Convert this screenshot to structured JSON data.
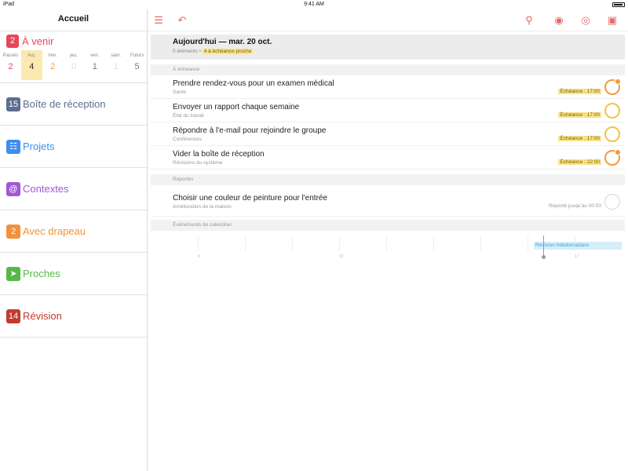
{
  "status": {
    "device": "iPad",
    "time": "9:41 AM"
  },
  "sidebar": {
    "title": "Accueil",
    "upcoming": {
      "count": "2",
      "label": "À venir",
      "days": [
        {
          "label": "Passés",
          "value": "2"
        },
        {
          "label": "Auj.",
          "value": "4"
        },
        {
          "label": "mer.",
          "value": "2"
        },
        {
          "label": "jeu.",
          "value": "0"
        },
        {
          "label": "ven.",
          "value": "1"
        },
        {
          "label": "sam.",
          "value": "1"
        },
        {
          "label": "Futurs",
          "value": "5"
        }
      ]
    },
    "items": [
      {
        "count": "15",
        "label": "Boîte de réception",
        "color": "#5c6f8f",
        "icon": "inbox-badge"
      },
      {
        "count": "",
        "label": "Projets",
        "color": "#3c8ef0",
        "icon": "projects-icon"
      },
      {
        "count": "",
        "label": "Contextes",
        "color": "#a356d6",
        "icon": "at-icon"
      },
      {
        "count": "2",
        "label": "Avec drapeau",
        "color": "#f2913a",
        "icon": "flag-badge"
      },
      {
        "count": "",
        "label": "Proches",
        "color": "#58b847",
        "icon": "nearby-icon"
      },
      {
        "count": "14",
        "label": "Révision",
        "color": "#c13b2e",
        "icon": "review-badge"
      }
    ]
  },
  "toolbar": {
    "icons": [
      "sidebar-toggle-icon",
      "undo-icon",
      "search-icon",
      "view-eye-icon",
      "focus-icon",
      "inbox-icon"
    ],
    "accent": "#e26a6a"
  },
  "today": {
    "title": "Aujourd'hui — mar. 20 oct.",
    "summary": "5 éléments",
    "highlight": "4 à échéance proche"
  },
  "sections": {
    "due": "À échéance",
    "deferred": "Reportés",
    "calendar": "Événements de calendrier"
  },
  "tasks_due": [
    {
      "name": "Prendre rendez-vous pour un examen médical",
      "context": "Santé",
      "due": "Échéance : 17:00",
      "state": "overdue"
    },
    {
      "name": "Envoyer un rapport chaque semaine",
      "context": "État du travail",
      "due": "Échéance : 17:00",
      "state": "due"
    },
    {
      "name": "Répondre à l'e-mail pour rejoindre le groupe",
      "context": "Conférences",
      "due": "Échéance : 17:00",
      "state": "due"
    },
    {
      "name": "Vider la boîte de réception",
      "context": "Révisions du système",
      "due": "Échéance : 22:00",
      "state": "overdue"
    }
  ],
  "tasks_deferred": [
    {
      "name": "Choisir une couleur de peinture pour l'entrée",
      "context": "Amélioration de la maison",
      "deferred": "Reporté jusqu'au 00:00"
    }
  ],
  "calendar": {
    "event": "Révision hebdomadaire",
    "ticks": [
      "9",
      "12",
      "17"
    ]
  }
}
